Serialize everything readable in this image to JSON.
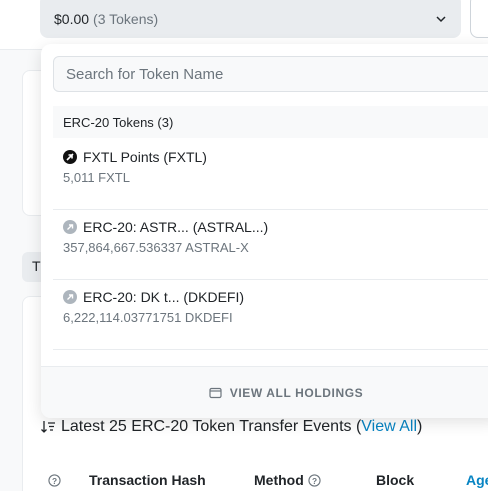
{
  "selector": {
    "amount": "$0.00",
    "token_count": "(3 Tokens)"
  },
  "dropdown": {
    "search_placeholder": "Search for Token Name",
    "group_header": "ERC-20 Tokens (3)",
    "tokens": [
      {
        "name": "FXTL Points (FXTL)",
        "balance": "5,011 FXTL",
        "icon": "token-logo-icon"
      },
      {
        "name": "ERC-20: ASTR... (ASTRAL...)",
        "balance": "357,864,667.536337 ASTRAL-X",
        "icon": "unknown-token-icon"
      },
      {
        "name": "ERC-20: DK t... (DKDEFI)",
        "balance": "6,222,114.03771751 DKDEFI",
        "icon": "unknown-token-icon"
      }
    ],
    "view_all_label": "VIEW ALL HOLDINGS"
  },
  "background": {
    "tab_initial": "T",
    "events_title": "Latest 25 ERC-20 Token Transfer Events (",
    "events_link": "View All",
    "events_close": ")",
    "columns": [
      "Transaction Hash",
      "Method",
      "Block",
      "Age"
    ]
  },
  "colors": {
    "link": "#0784c3",
    "muted": "#6c757d",
    "header_bg": "#f8f9fa"
  }
}
